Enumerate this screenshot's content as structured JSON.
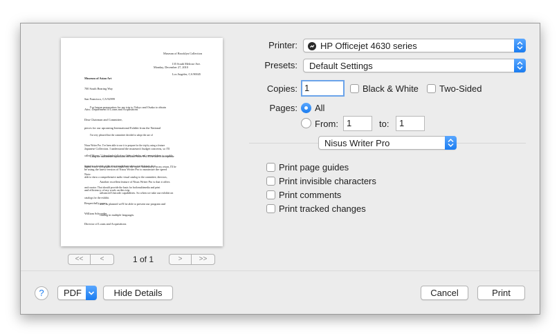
{
  "preview": {
    "letter": {
      "sender_address": [
        "Museum of Brooklyn Collection",
        "135 South Melrose Ave.",
        "Los Angeles, CA 90045"
      ],
      "date": "Monday, December 27, 2010",
      "recipient": [
        "Museum of Asian Art",
        "700 South Bearing Way",
        "San Francisco, CA 92999",
        "Attn.: Department of Loans and Acquisitions"
      ],
      "salutation": "Dear Chairman and Committee,",
      "para1": [
        "I've begun preparation for my trip to Tokyo and Osaka to obtain",
        "pieces for our upcoming International Exhibit from the National",
        "Japanese Collection. I understand the museum's budget concerns, so I'll",
        "be using the latest version of Nisus Writer Pro to maximize the speed",
        "and efficiency of my work on this trip."
      ],
      "para2": [
        "I'm very pleased that the committee decided to adopt the use of",
        "Nisus Writer Pro. I've been able to use it to prepare for the trip by using a feature",
        "called \"Macros.\" I downloaded all of my flight schedules and converted them to a usable",
        "format in a fraction of the time it might have taken a travel firm to do it."
      ],
      "para3": [
        "Using the multimedia capabilities of Nisus Writer Pro, I'll be able to incorporate",
        "digital video, still graphics, and sound into my report. Immediately on my return, I'll be",
        "able to show a comprehensive audio visual catalog to the committee, directors,",
        "and curator. That should provide the basis for both multimedia and print",
        "catalogs for the exhibit."
      ],
      "note_label": "Note:",
      "note": [
        "Another excellent feature of Nisus Writer Pro is that it offers",
        "advanced Unicode capabilities. So when we take our exhibit on",
        "tour, as planned we'll be able to present our program and",
        "catalog in multiple languages."
      ],
      "closing": [
        "Respectfully yours,",
        "William Schroeder",
        "Director of Loans and Acquisitions"
      ]
    },
    "first_label": "<<",
    "prev_label": "<",
    "next_label": ">",
    "last_label": ">>",
    "page_indicator": "1 of 1"
  },
  "printer": {
    "label": "Printer:",
    "value": "HP Officejet 4630 series",
    "icon": "printer-status-icon"
  },
  "presets": {
    "label": "Presets:",
    "value": "Default Settings"
  },
  "copies": {
    "label": "Copies:",
    "value": "1",
    "bw_label": "Black & White",
    "two_sided_label": "Two-Sided"
  },
  "pages": {
    "label": "Pages:",
    "all_label": "All",
    "from_label": "From:",
    "from_value": "1",
    "to_label": "to:",
    "to_value": "1"
  },
  "panel_select": {
    "value": "Nisus Writer Pro"
  },
  "options": [
    {
      "label": "Print page guides"
    },
    {
      "label": "Print invisible characters"
    },
    {
      "label": "Print comments"
    },
    {
      "label": "Print tracked changes"
    }
  ],
  "footer": {
    "help_label": "?",
    "pdf_label": "PDF",
    "hide_details_label": "Hide Details",
    "cancel_label": "Cancel",
    "print_label": "Print"
  },
  "colors": {
    "accent": "#1a7cf0",
    "dialog_bg": "#ececec",
    "focus_ring": "#6aa3ea"
  }
}
